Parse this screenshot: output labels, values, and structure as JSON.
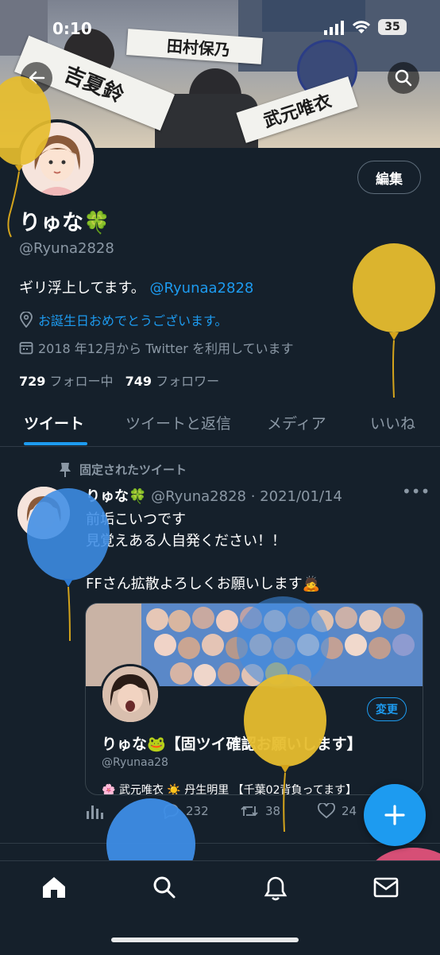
{
  "status_bar": {
    "time": "0:10",
    "battery": "35"
  },
  "banner": {
    "sash_1": "吉夏鈴",
    "sash_2": "田村保乃",
    "sash_3": "武元唯衣"
  },
  "header_buttons": {
    "back_icon": "back-arrow-icon",
    "search_icon": "search-icon"
  },
  "profile": {
    "edit_label": "編集",
    "display_name": "りゅな🍀",
    "handle": "@Ryuna2828",
    "bio_text": "ギリ浮上してます。",
    "bio_mention": "@Ryunaa2828",
    "birthday_text": "お誕生日おめでとうございます。",
    "joined_text": "2018 年12月から Twitter を利用しています",
    "following_count": "729",
    "following_label": "フォロー中",
    "followers_count": "749",
    "followers_label": "フォロワー"
  },
  "tabs": [
    {
      "label": "ツイート",
      "active": true
    },
    {
      "label": "ツイートと返信",
      "active": false
    },
    {
      "label": "メディア",
      "active": false
    },
    {
      "label": "いいね",
      "active": false
    }
  ],
  "tweet": {
    "pinned_label": "固定されたツイート",
    "author_name": "りゅな🍀",
    "author_handle": "@Ryuna2828",
    "date": "· 2021/01/14",
    "more_icon": "more-icon",
    "line1": "前垢こいつです",
    "line2": "見覚えある人自発ください！！",
    "line3": "FFさん拡散よろしくお願いします🙇",
    "embed": {
      "change_label": "変更",
      "name": "りゅな🐸【固ツイ確認お願いします】",
      "handle": "@Ryunaa28",
      "bio": "🌸 武元唯衣 ☀️ 丹生明里 【千葉02背負ってます】"
    },
    "replies": "232",
    "retweets": "38",
    "likes": "24"
  },
  "fab_icon": "plus-icon",
  "bottom_nav": [
    "home-icon",
    "search-icon",
    "notifications-icon",
    "messages-icon"
  ],
  "colors": {
    "background": "#15202b",
    "accent": "#1d9bf0",
    "muted": "#8b98a5"
  }
}
